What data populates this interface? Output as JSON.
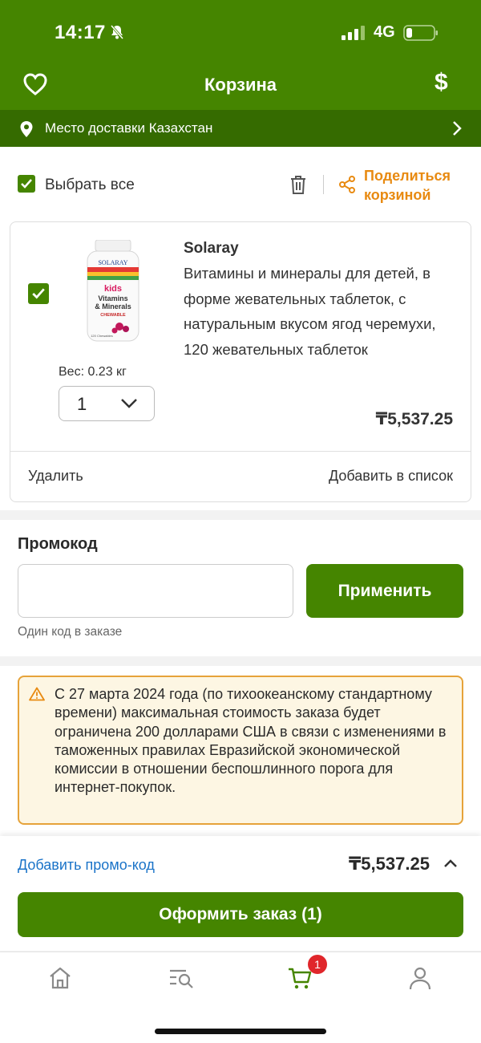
{
  "status_bar": {
    "time": "14:17",
    "network": "4G"
  },
  "nav": {
    "title": "Корзина",
    "currency_symbol": "$"
  },
  "delivery": {
    "text": "Место доставки Казахстан"
  },
  "cart_controls": {
    "select_all_label": "Выбрать все",
    "share_line1": "Поделиться",
    "share_line2": "корзиной"
  },
  "item": {
    "brand": "Solaray",
    "name": "Витамины и минералы для детей, в форме жевательных таблеток, с натуральным вкусом ягод черемухи, 120 жевательных таблеток",
    "weight": "Вес: 0.23 кг",
    "quantity": "1",
    "price": "₸5,537.25",
    "remove_label": "Удалить",
    "add_to_list_label": "Добавить в список",
    "bottle_brand": "SOLARAY",
    "bottle_line1": "kids",
    "bottle_line2": "Vitamins",
    "bottle_line3": "& Minerals",
    "bottle_line4": "CHEWABLE",
    "bottle_count": "120 Chewables"
  },
  "promo": {
    "title": "Промокод",
    "input_value": "",
    "input_placeholder": "",
    "apply_label": "Применить",
    "hint": "Один код в заказе"
  },
  "notice": {
    "text": "С 27 марта 2024 года (по тихоокеанскому стандартному времени) максимальная стоимость заказа будет ограничена 200 долларами США в связи с изменениями в таможенных правилах Евразийской экономической комиссии в отношении беспошлинного порога для интернет-покупок."
  },
  "summary": {
    "add_promo_label": "Добавить промо-код",
    "total": "₸5,537.25",
    "checkout_label": "Оформить заказ (1)"
  },
  "tabbar": {
    "cart_badge": "1"
  },
  "colors": {
    "brand_green": "#458500",
    "dark_green": "#356b00",
    "accent_orange": "#e88a11",
    "link_blue": "#1a73c8",
    "badge_red": "#e0262b"
  }
}
